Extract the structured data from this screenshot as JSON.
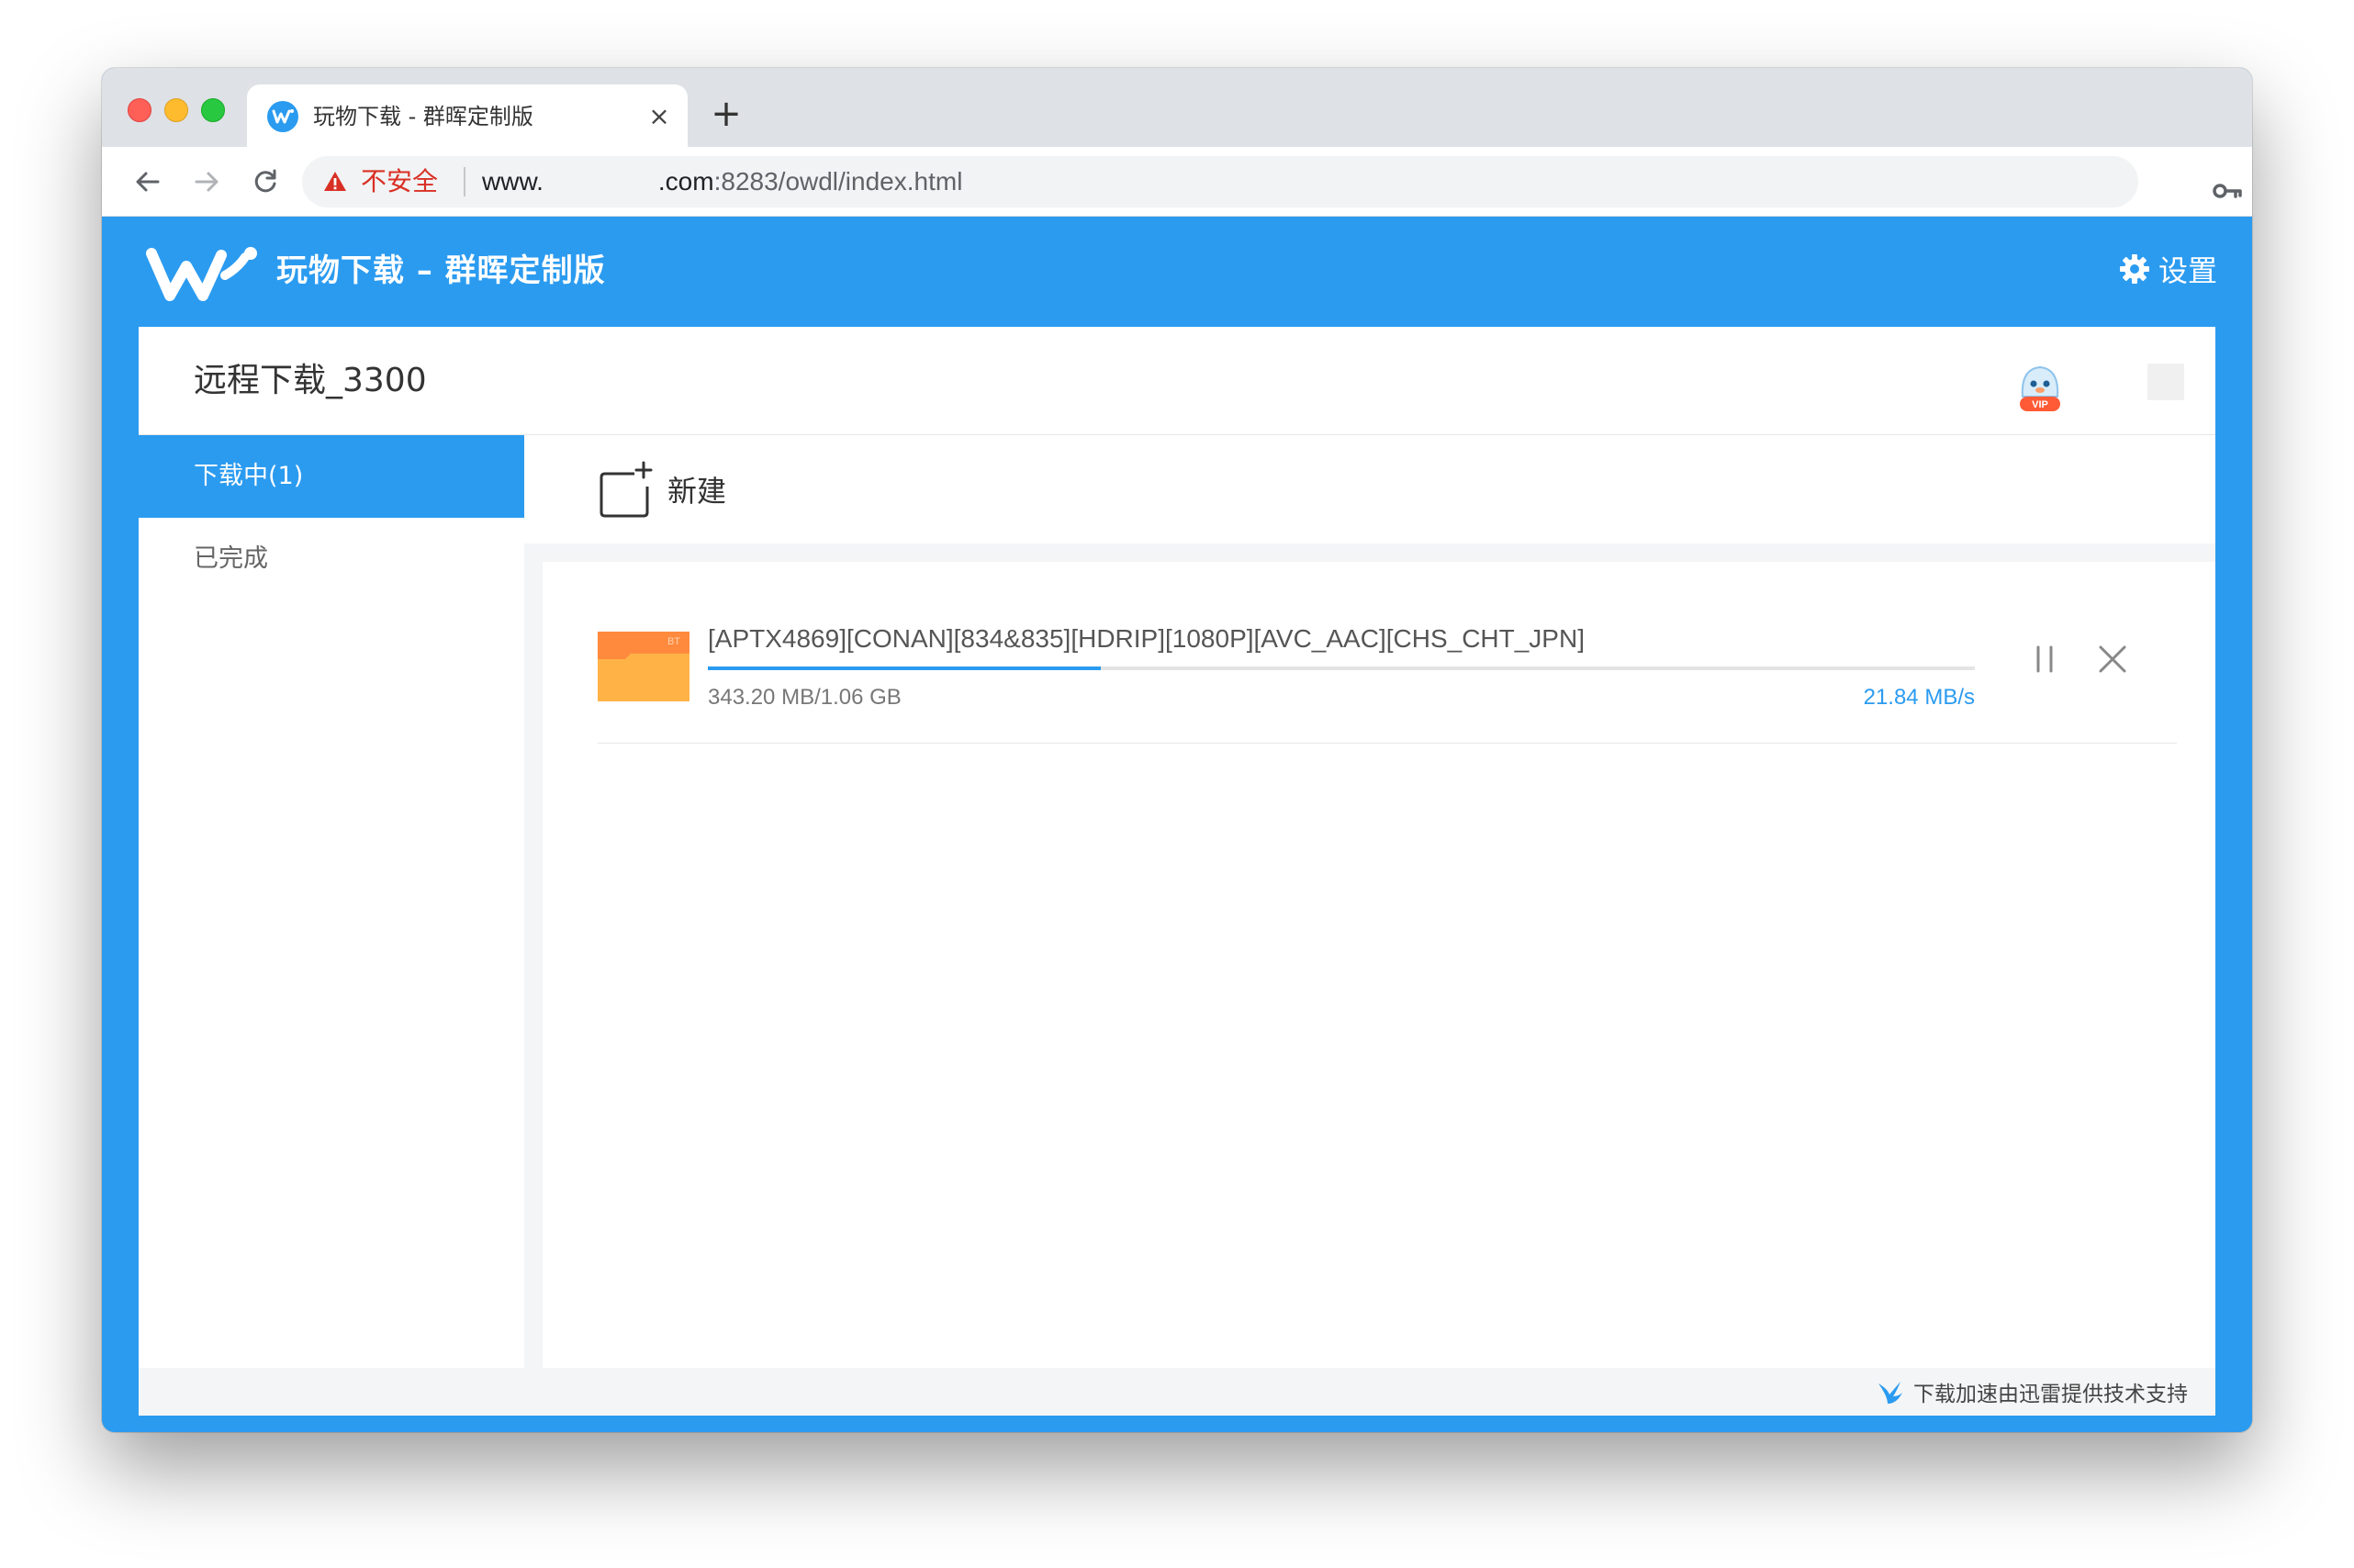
{
  "browser": {
    "tab": {
      "title": "玩物下载 - 群晖定制版",
      "close_glyph": "×",
      "favicon": "wanwu-logo-icon"
    },
    "new_tab_glyph": "+",
    "address_bar": {
      "security_label": "不安全",
      "url_prefix": "www.",
      "url_domain_suffix": ".com",
      "url_path": ":8283/owdl/index.html"
    },
    "icons": [
      "back-arrow-icon",
      "forward-arrow-icon",
      "reload-icon",
      "warning-icon",
      "key-icon",
      "star-icon",
      "avatar",
      "more-vert-icon"
    ]
  },
  "app": {
    "title": "玩物下载 – 群晖定制版",
    "settings_label": "设置",
    "device_name": "远程下载_3300",
    "vip_badge": "VIP",
    "sidebar": {
      "items": [
        {
          "label": "下载中(1)",
          "active": true
        },
        {
          "label": "已完成",
          "active": false
        }
      ]
    },
    "new_task_label": "新建",
    "tasks": [
      {
        "name": "[APTX4869][CONAN][834&835][HDRIP][1080P][AVC_AAC][CHS_CHT_JPN]",
        "file_badge": "BT",
        "size_progress": "343.20 MB/1.06 GB",
        "speed": "21.84 MB/s",
        "progress_fraction": 0.31
      }
    ],
    "footer": "下载加速由迅雷提供技术支持"
  },
  "colors": {
    "brand_blue": "#2b9bf0",
    "insecure_red": "#d93025",
    "folder_orange": "#ff8a3d"
  }
}
